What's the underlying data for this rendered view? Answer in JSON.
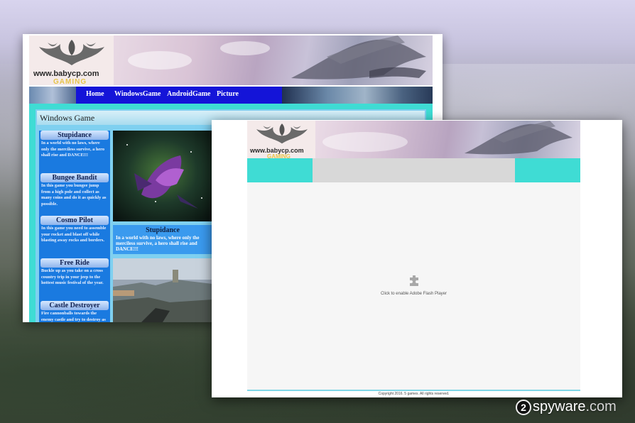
{
  "back_window": {
    "logo": {
      "url": "www.babycp.com",
      "tag": "GAMING"
    },
    "nav": [
      "Home",
      "WindowsGame",
      "AndroidGame",
      "Picture"
    ],
    "section_title": "Windows Game",
    "games": [
      {
        "title": "Stupidance",
        "desc": "In a world with no laws, where only the merciless survive, a hero shall rise and DANCE!!!"
      },
      {
        "title": "Bungee Bandit",
        "desc": "In this game you bungee jump from a high pole and collect as many coins and do it as quickly as possible."
      },
      {
        "title": "Cosmo Pilot",
        "desc": "In this game you need to assemble your rocket and blast off while blasting away rocks and borders."
      },
      {
        "title": "Free Ride",
        "desc": "Buckle up as you take on a cross country trip in your jeep to the hottest music festival of the year."
      },
      {
        "title": "Castle Destroyer",
        "desc": "Fire cannonballs towards the enemy castle and try to destroy as"
      }
    ],
    "featured": {
      "title": "Stupidance",
      "desc": "In a world with no laws, where only the merciless survive, a hero shall rise and DANCE!!!"
    }
  },
  "front_window": {
    "logo": {
      "url": "www.babycp.com",
      "tag": "GAMING"
    },
    "flash_prompt": "Click to enable Adobe Flash Player",
    "footer": "Copyright 2016. 5 games. All rights reserved."
  },
  "watermark": {
    "badge": "2",
    "brand": "spyware",
    "suffix": ".com"
  },
  "colors": {
    "nav_blue": "#1414d8",
    "turquoise": "#3fdcd4",
    "list_blue": "#1a7ae0"
  }
}
